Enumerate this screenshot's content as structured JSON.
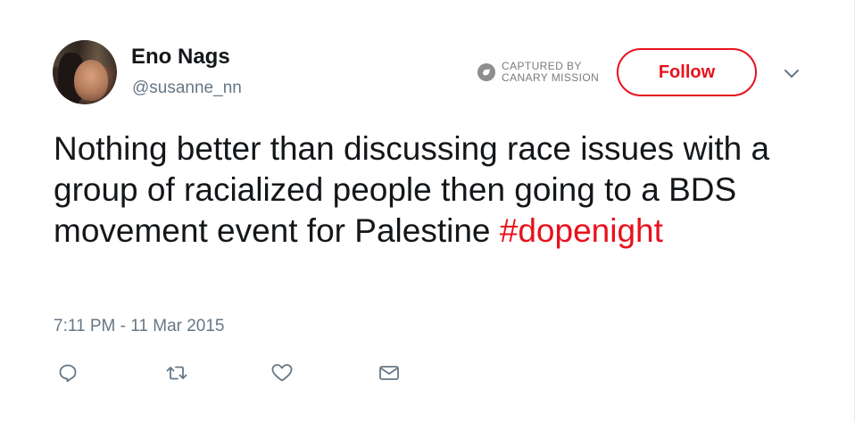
{
  "user": {
    "display_name": "Eno Nags",
    "handle": "@susanne_nn"
  },
  "watermark": {
    "line1": "CAPTURED BY",
    "line2": "CANARY MISSION"
  },
  "follow_button": {
    "label": "Follow"
  },
  "tweet": {
    "text": "Nothing better than discussing race issues with a group of racialized people then going to a BDS movement event for Palestine",
    "hashtag": "#dopenight",
    "timestamp": "7:11 PM - 11 Mar 2015"
  },
  "actions": [
    {
      "icon": "reply-icon"
    },
    {
      "icon": "retweet-icon"
    },
    {
      "icon": "like-icon"
    },
    {
      "icon": "direct-message-icon"
    }
  ],
  "colors": {
    "accent": "#e8111c",
    "text": "#14171a",
    "secondary_text": "#657786",
    "icon": "#657786"
  }
}
